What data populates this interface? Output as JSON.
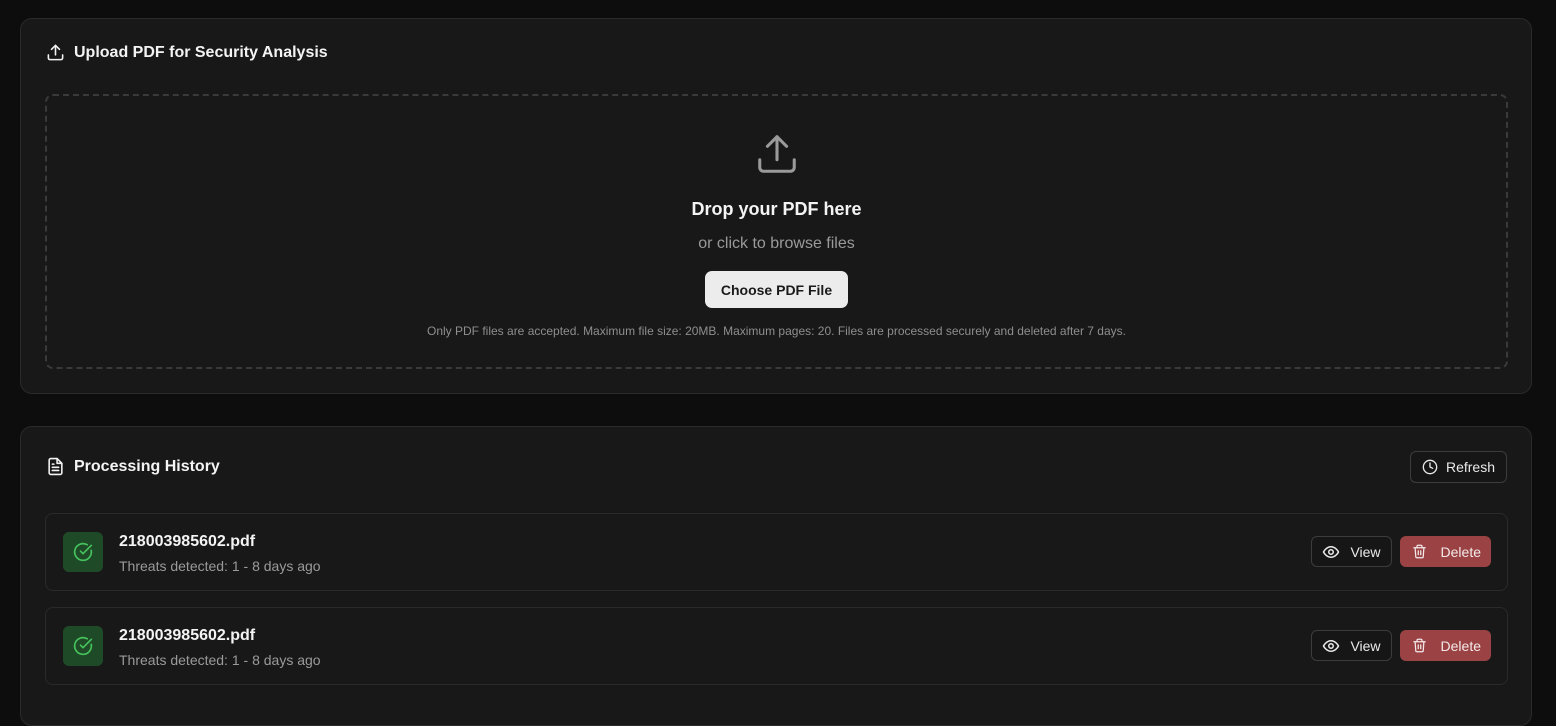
{
  "upload": {
    "title": "Upload PDF for Security Analysis",
    "title_icon": "upload-icon",
    "drop_icon": "upload-icon",
    "drop_title": "Drop your PDF here",
    "drop_subtitle": "or click to browse files",
    "choose_button": "Choose PDF File",
    "note": "Only PDF files are accepted. Maximum file size: 20MB. Maximum pages: 20. Files are processed securely and deleted after 7 days."
  },
  "history": {
    "title": "Processing History",
    "title_icon": "file-text-icon",
    "refresh_label": "Refresh",
    "refresh_icon": "clock-icon",
    "items": [
      {
        "filename": "218003985602.pdf",
        "meta": "Threats detected: 1 - 8 days ago",
        "status_icon": "check-circle-icon",
        "view_label": "View",
        "delete_label": "Delete"
      },
      {
        "filename": "218003985602.pdf",
        "meta": "Threats detected: 1 - 8 days ago",
        "status_icon": "check-circle-icon",
        "view_label": "View",
        "delete_label": "Delete"
      }
    ]
  },
  "colors": {
    "background": "#0d0d0d",
    "card": "#181818",
    "status_bg": "#1f4a28",
    "status_fg": "#46c25c",
    "delete_bg": "#9b4344"
  }
}
